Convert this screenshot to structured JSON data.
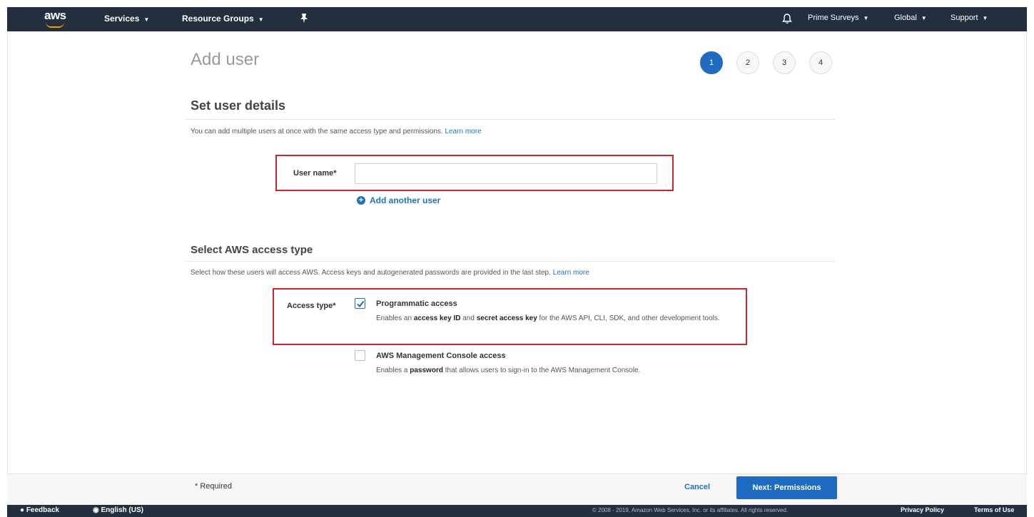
{
  "topnav": {
    "logo_text": "aws",
    "services_label": "Services",
    "resource_groups_label": "Resource Groups",
    "account_label": "Prime Surveys",
    "region_label": "Global",
    "support_label": "Support"
  },
  "page": {
    "title": "Add user",
    "steps": [
      "1",
      "2",
      "3",
      "4"
    ],
    "active_step": 1
  },
  "details": {
    "title": "Set user details",
    "description": "You can add multiple users at once with the same access type and permissions.",
    "learn_more": "Learn more",
    "user_name_label": "User name*",
    "user_name_value": "",
    "add_another_user": "Add another user"
  },
  "access": {
    "title": "Select AWS access type",
    "description": "Select how these users will access AWS. Access keys and autogenerated passwords are provided in the last step.",
    "learn_more": "Learn more",
    "access_type_label": "Access type*",
    "programmatic": {
      "title": "Programmatic access",
      "checked": true,
      "desc_pre": "Enables an ",
      "desc_b1": "access key ID",
      "desc_mid": " and ",
      "desc_b2": "secret access key",
      "desc_post": " for the AWS API, CLI, SDK, and other development tools."
    },
    "console": {
      "title": "AWS Management Console access",
      "checked": false,
      "desc_pre": "Enables a ",
      "desc_b1": "password",
      "desc_post": " that allows users to sign-in to the AWS Management Console."
    }
  },
  "footer": {
    "required_note": "* Required",
    "cancel_label": "Cancel",
    "next_label": "Next: Permissions"
  },
  "bottom_bar": {
    "feedback_label": "Feedback",
    "language_label": "English (US)",
    "copyright": "© 2008 - 2019, Amazon Web Services, Inc. or its affiliates. All rights reserved.",
    "privacy_label": "Privacy Policy",
    "terms_label": "Terms of Use"
  },
  "colors": {
    "nav_bg": "#232f3e",
    "primary": "#1f6bc2",
    "link": "#1e73be",
    "highlight_box": "#c5282c",
    "logo_accent": "#ff9900"
  }
}
